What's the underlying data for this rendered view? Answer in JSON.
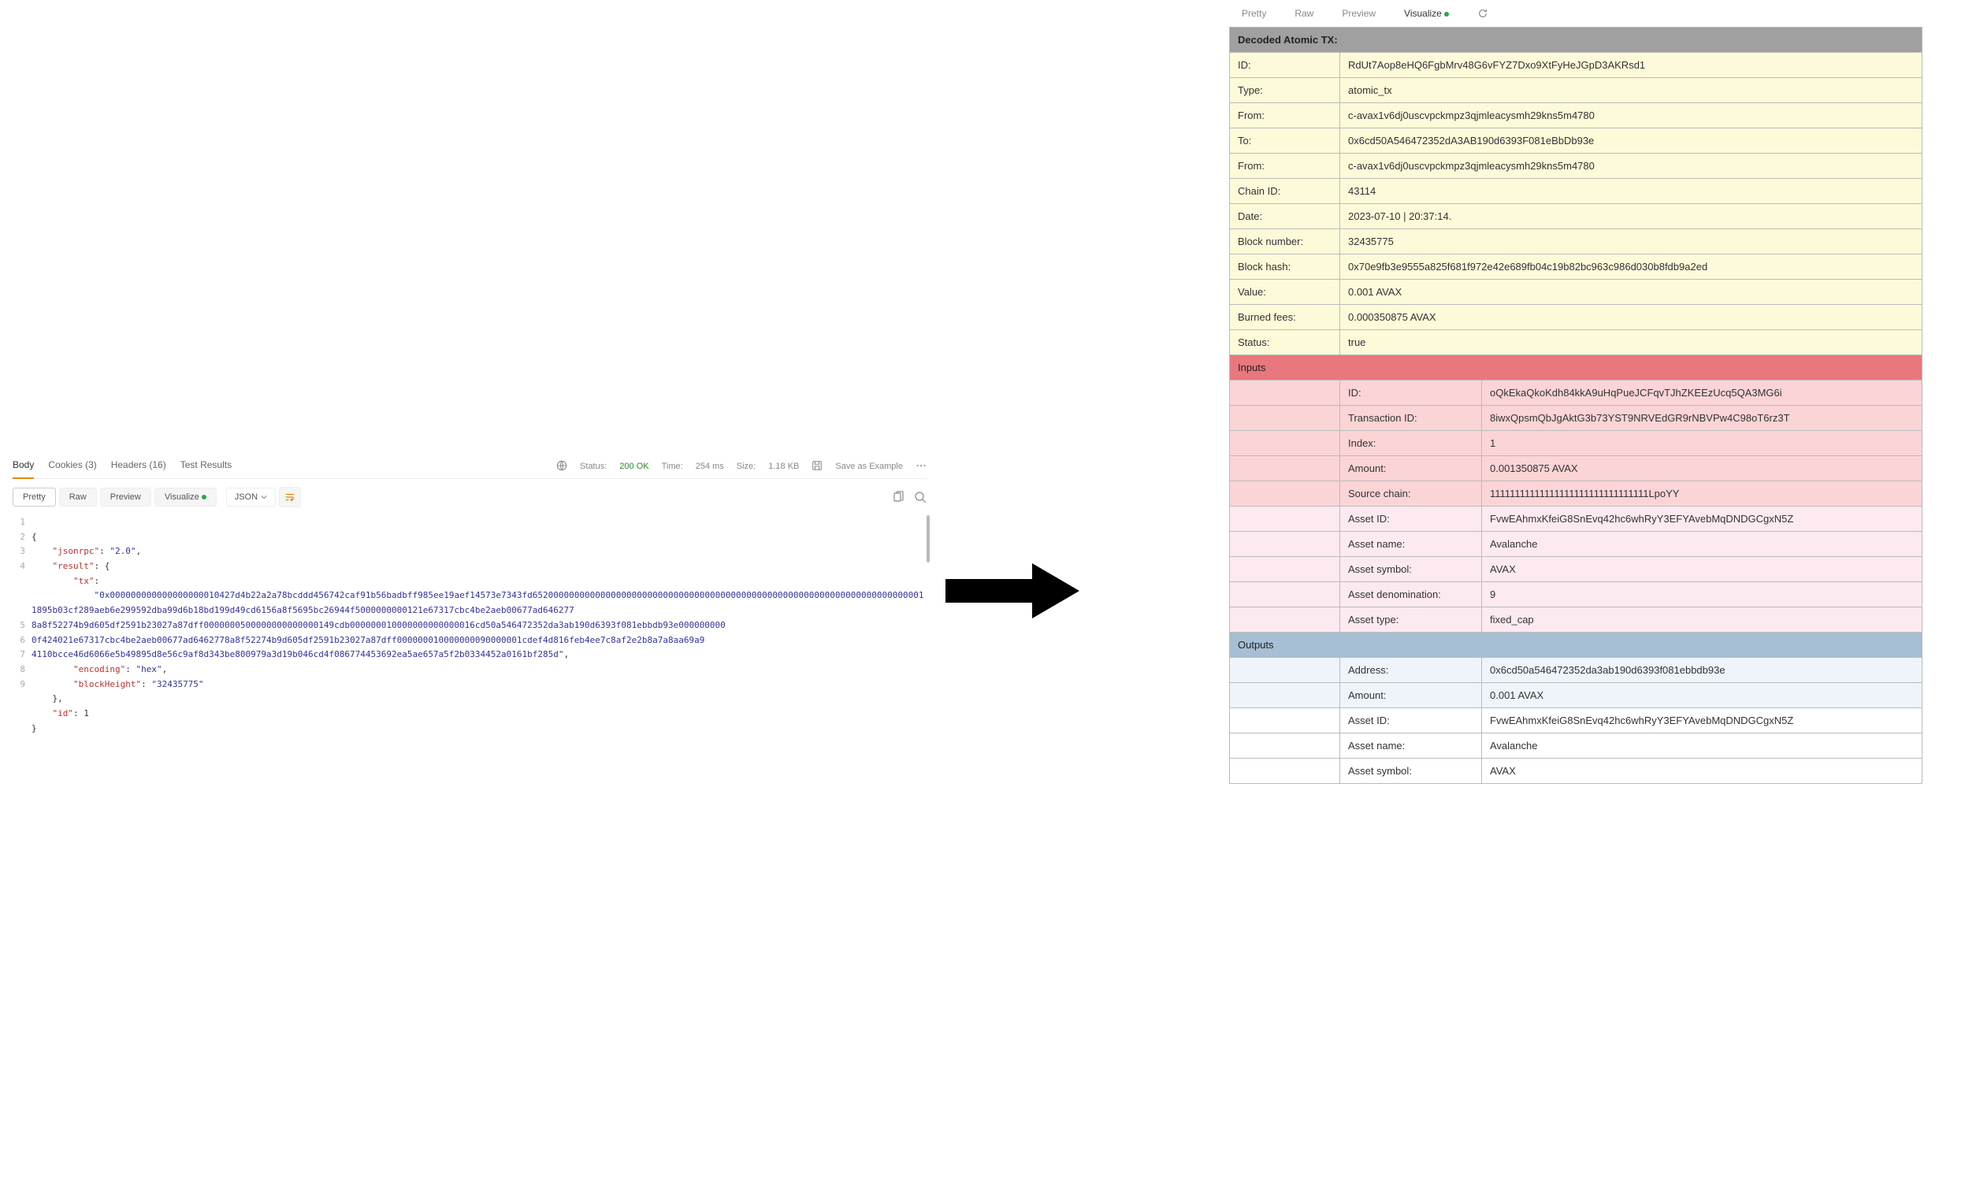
{
  "left": {
    "tabs": {
      "body": "Body",
      "cookies": "Cookies (3)",
      "headers": "Headers (16)",
      "test_results": "Test Results"
    },
    "status": {
      "status_label": "Status:",
      "status_val": "200 OK",
      "time_label": "Time:",
      "time_val": "254 ms",
      "size_label": "Size:",
      "size_val": "1.18 KB",
      "save": "Save as Example"
    },
    "sub": {
      "pretty": "Pretty",
      "raw": "Raw",
      "preview": "Preview",
      "visualize": "Visualize",
      "json": "JSON"
    },
    "code": {
      "lines": [
        "1",
        "2",
        "3",
        "4",
        "5",
        "6",
        "7",
        "8",
        "9"
      ],
      "jsonrpc_k": "\"jsonrpc\"",
      "jsonrpc_v": "\"2.0\"",
      "result_k": "\"result\"",
      "tx_k": "\"tx\"",
      "tx_v": "\"0x000000000000000000010427d4b22a2a78bcddd456742caf91b56badbff985ee19aef14573e7343fd6520000000000000000000000000000000000000000000000000000000000000000000000011895b03cf289aeb6e299592dba99d6b18bd199d49cd6156a8f5695bc26944f5000000000121e67317cbc4be2aeb00677ad646277\n8a8f52274b9d605df2591b23027a87dff0000000500000000000000149cdb000000010000000000000016cd50a546472352da3ab190d6393f081ebbdb93e000000000\n0f424021e67317cbc4be2aeb00677ad6462778a8f52274b9d605df2591b23027a87dff000000010000000090000001cdef4d816feb4ee7c8af2e2b8a7a8aa69a9\n4110bcce46d6066e5b49895d8e56c9af8d343be800979a3d19b046cd4f086774453692ea5ae657a5f2b0334452a0161bf285d\"",
      "enc_k": "\"encoding\"",
      "enc_v": "\"hex\"",
      "bh_k": "\"blockHeight\"",
      "bh_v": "\"32435775\"",
      "id_k": "\"id\"",
      "id_v": "1"
    }
  },
  "right": {
    "tabs": {
      "pretty": "Pretty",
      "raw": "Raw",
      "preview": "Preview",
      "visualize": "Visualize"
    },
    "header": "Decoded Atomic TX:",
    "main": [
      [
        "ID:",
        "RdUt7Aop8eHQ6FgbMrv48G6vFYZ7Dxo9XtFyHeJGpD3AKRsd1"
      ],
      [
        "Type:",
        "atomic_tx"
      ],
      [
        "From:",
        "c-avax1v6dj0uscvpckmpz3qjmleacysmh29kns5m4780"
      ],
      [
        "To:",
        "0x6cd50A546472352dA3AB190d6393F081eBbDb93e"
      ],
      [
        "From:",
        "c-avax1v6dj0uscvpckmpz3qjmleacysmh29kns5m4780"
      ],
      [
        "Chain ID:",
        "43114"
      ],
      [
        "Date:",
        "2023-07-10 | 20:37:14."
      ],
      [
        "Block number:",
        "32435775"
      ],
      [
        "Block hash:",
        "0x70e9fb3e9555a825f681f972e42e689fb04c19b82bc963c986d030b8fdb9a2ed"
      ],
      [
        "Value:",
        "0.001 AVAX"
      ],
      [
        "Burned fees:",
        "0.000350875 AVAX"
      ],
      [
        "Status:",
        "true"
      ]
    ],
    "inputs_hdr": "Inputs",
    "inputs": [
      [
        "ID:",
        "oQkEkaQkoKdh84kkA9uHqPueJCFqvTJhZKEEzUcq5QA3MG6i",
        "pink"
      ],
      [
        "Transaction ID:",
        "8iwxQpsmQbJgAktG3b73YST9NRVEdGR9rNBVPw4C98oT6rz3T",
        "pink"
      ],
      [
        "Index:",
        "1",
        "pink"
      ],
      [
        "Amount:",
        "0.001350875 AVAX",
        "pink"
      ],
      [
        "Source chain:",
        "11111111111111111111111111111111LpoYY",
        "pink"
      ],
      [
        "Asset ID:",
        "FvwEAhmxKfeiG8SnEvq42hc6whRyY3EFYAvebMqDNDGCgxN5Z",
        "pink-lt"
      ],
      [
        "Asset name:",
        "Avalanche",
        "pink-lt"
      ],
      [
        "Asset symbol:",
        "AVAX",
        "pink-lt"
      ],
      [
        "Asset denomination:",
        "9",
        "pink-lt"
      ],
      [
        "Asset type:",
        "fixed_cap",
        "pink-lt"
      ]
    ],
    "outputs_hdr": "Outputs",
    "outputs": [
      [
        "Address:",
        "0x6cd50a546472352da3ab190d6393f081ebbdb93e",
        "blue-lt"
      ],
      [
        "Amount:",
        "0.001 AVAX",
        "blue-lt"
      ],
      [
        "Asset ID:",
        "FvwEAhmxKfeiG8SnEvq42hc6whRyY3EFYAvebMqDNDGCgxN5Z",
        "white"
      ],
      [
        "Asset name:",
        "Avalanche",
        "white"
      ],
      [
        "Asset symbol:",
        "AVAX",
        "white"
      ]
    ]
  }
}
